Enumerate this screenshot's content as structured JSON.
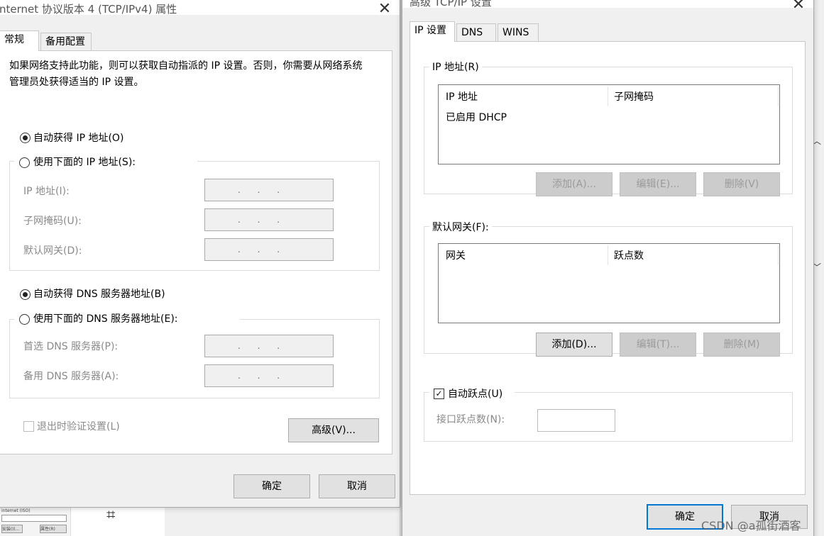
{
  "background": {
    "icon_glyph": "⌗",
    "mini_panel": {
      "label": "internet (ISO)",
      "btn1": "安装(I)...",
      "btn2": "属性(R)"
    }
  },
  "left_window": {
    "title": "nternet 协议版本 4 (TCP/IPv4) 属性",
    "close_glyph": "✕",
    "tabs": [
      {
        "label": "常规",
        "active": true
      },
      {
        "label": "备用配置",
        "active": false
      }
    ],
    "description": "如果网络支持此功能，则可以获取自动指派的 IP 设置。否则，你需要从网络系统管理员处获得适当的 IP 设置。",
    "ip_section": {
      "auto_radio": "自动获得 IP 地址(O)",
      "manual_radio": "使用下面的 IP 地址(S):",
      "fields": [
        {
          "label": "IP 地址(I):",
          "value": ".   .   ."
        },
        {
          "label": "子网掩码(U):",
          "value": ".   .   ."
        },
        {
          "label": "默认网关(D):",
          "value": ".   .   ."
        }
      ]
    },
    "dns_section": {
      "auto_radio": "自动获得 DNS 服务器地址(B)",
      "manual_radio": "使用下面的 DNS 服务器地址(E):",
      "fields": [
        {
          "label": "首选 DNS 服务器(P):",
          "value": ".   .   ."
        },
        {
          "label": "备用 DNS 服务器(A):",
          "value": ".   .   ."
        }
      ]
    },
    "validate_checkbox": "退出时验证设置(L)",
    "advanced_button": "高级(V)...",
    "ok_button": "确定",
    "cancel_button": "取消"
  },
  "right_window": {
    "title": "高级 TCP/IP 设置",
    "close_glyph": "✕",
    "tabs": [
      {
        "label": "IP 设置",
        "active": true
      },
      {
        "label": "DNS",
        "active": false
      },
      {
        "label": "WINS",
        "active": false
      }
    ],
    "ip_group": {
      "caption": "IP 地址(R)",
      "columns": [
        "IP 地址",
        "子网掩码"
      ],
      "rows": [
        "已启用 DHCP"
      ],
      "add": "添加(A)...",
      "edit": "编辑(E)...",
      "remove": "删除(V)"
    },
    "gateway_group": {
      "caption": "默认网关(F):",
      "columns": [
        "网关",
        "跃点数"
      ],
      "add": "添加(D)...",
      "edit": "编辑(T)...",
      "remove": "删除(M)"
    },
    "metric_group": {
      "auto_metric": "自动跃点(U)",
      "interface_metric_label": "接口跃点数(N):",
      "interface_metric_value": ""
    },
    "ok_button": "确定",
    "cancel_button": "取消"
  },
  "watermark": "CSDN @a孤街酒客",
  "colors": {
    "window_bg": "#f0f0f0",
    "panel_bg": "#ffffff",
    "accent": "#0078d7",
    "disabled_text": "#8a8a8a"
  }
}
